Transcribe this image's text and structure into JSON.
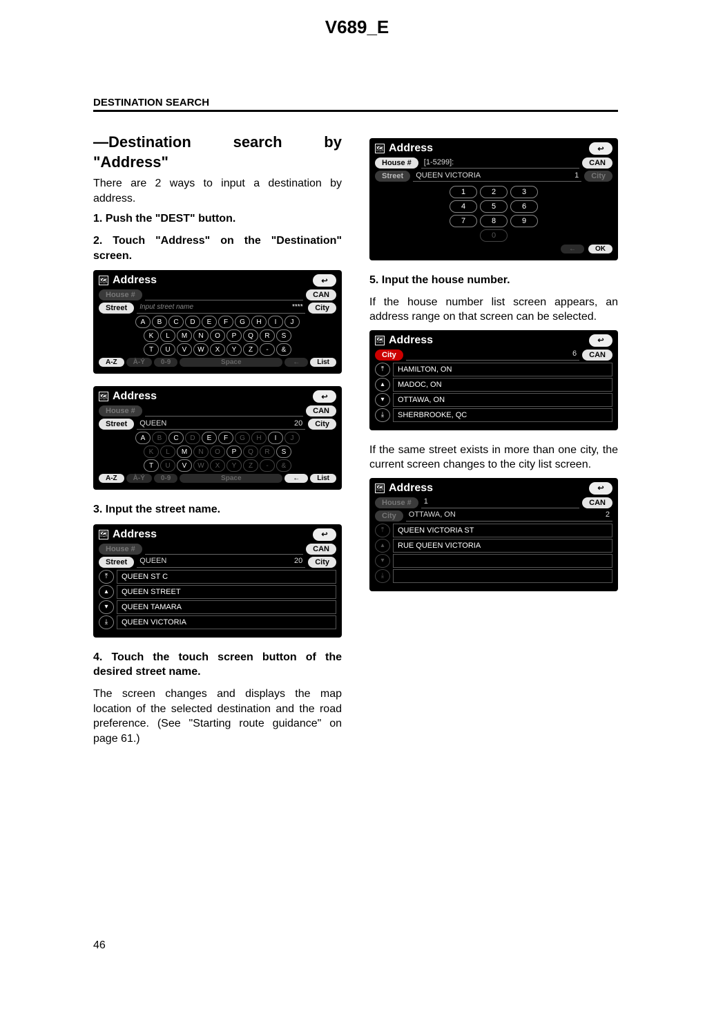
{
  "doc": {
    "model": "V689_E",
    "section": "DESTINATION SEARCH",
    "title": "—Destination search by \"Address\"",
    "intro": "There are 2 ways to input a destination by address.",
    "steps": {
      "s1": "1.  Push the \"DEST\" button.",
      "s2": "2.  Touch \"Address\" on the \"Destination\" screen.",
      "s3": "3.  Input the street name.",
      "s4": "4.  Touch the touch screen button of the desired street name.",
      "s4_body": "The screen changes and displays the map location of the selected destination and the road preference. (See \"Starting route guidance\" on page 61.)",
      "s5": "5.  Input the house number.",
      "s5_body1": "If the house number list screen appears, an address range on that screen can be selected.",
      "s5_body2": "If the same street exists in more than one city, the current screen changes to the city list screen."
    },
    "page": "46"
  },
  "ui": {
    "address_label": "Address",
    "back_icon": "↩",
    "house_label": "House #",
    "street_label": "Street",
    "city_label": "City",
    "can_label": "CAN",
    "ok_label": "OK",
    "list_label": "List",
    "space_label": "Space",
    "arrow_left": "←",
    "input_placeholder": "Input street name",
    "dots4": "****",
    "queen_value": "QUEEN",
    "match20": "20",
    "queen_victoria": "QUEEN VICTORIA",
    "match1": "1",
    "match2": "2",
    "match6": "6",
    "house_range": "[1-5299]:",
    "house_value": "1",
    "ottawa_on": "OTTAWA, ON",
    "keys": {
      "row1": [
        "A",
        "B",
        "C",
        "D",
        "E",
        "F",
        "G",
        "H",
        "I",
        "J"
      ],
      "row2": [
        "K",
        "L",
        "M",
        "N",
        "O",
        "P",
        "Q",
        "R",
        "S"
      ],
      "row3": [
        "T",
        "U",
        "V",
        "W",
        "X",
        "Y",
        "Z",
        "-",
        "&"
      ],
      "row4": [
        "A-Z",
        "À-Ý",
        "0-9"
      ]
    },
    "keys_dim_shot2": {
      "row1": [
        "A",
        "C",
        "E",
        "F",
        "I"
      ],
      "row2": [
        "M",
        "P",
        "S"
      ],
      "row3": [
        "T",
        "V"
      ],
      "row4": [
        "A-Z"
      ]
    },
    "street_list": [
      "QUEEN ST C",
      "QUEEN STREET",
      "QUEEN TAMARA",
      "QUEEN VICTORIA"
    ],
    "city_list": [
      "HAMILTON, ON",
      "MADOC, ON",
      "OTTAWA, ON",
      "SHERBROOKE, QC"
    ],
    "street_list2": [
      "QUEEN VICTORIA ST",
      "RUE QUEEN VICTORIA",
      "",
      ""
    ],
    "numpad": [
      [
        "1",
        "2",
        "3"
      ],
      [
        "4",
        "5",
        "6"
      ],
      [
        "7",
        "8",
        "9"
      ],
      [
        "0"
      ]
    ]
  }
}
